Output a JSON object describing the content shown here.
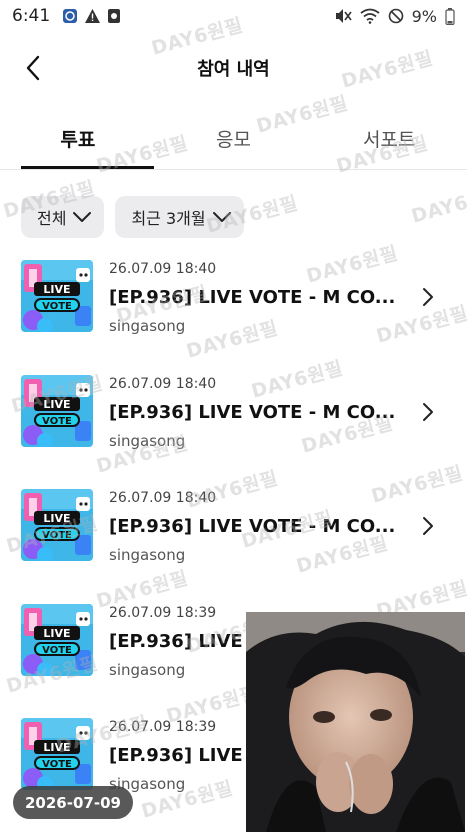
{
  "status_bar": {
    "time": "6:41",
    "battery": "9%"
  },
  "header": {
    "title": "참여 내역"
  },
  "tabs": [
    {
      "label": "투표",
      "active": true
    },
    {
      "label": "응모",
      "active": false
    },
    {
      "label": "서포트",
      "active": false
    }
  ],
  "filters": {
    "type": "전체",
    "period": "최근 3개월"
  },
  "items": [
    {
      "date": "26.07.09 18:40",
      "title": "[EP.936] LIVE VOTE - M CO...",
      "subtitle": "singasong",
      "thumb_text_1": "LIVE",
      "thumb_text_2": "VOTE"
    },
    {
      "date": "26.07.09 18:40",
      "title": "[EP.936] LIVE VOTE - M CO...",
      "subtitle": "singasong",
      "thumb_text_1": "LIVE",
      "thumb_text_2": "VOTE"
    },
    {
      "date": "26.07.09 18:40",
      "title": "[EP.936] LIVE VOTE - M CO...",
      "subtitle": "singasong",
      "thumb_text_1": "LIVE",
      "thumb_text_2": "VOTE"
    },
    {
      "date": "26.07.09 18:39",
      "title": "[EP.936] LIVE",
      "subtitle": "singasong",
      "thumb_text_1": "LIVE",
      "thumb_text_2": "VOTE"
    },
    {
      "date": "26.07.09 18:39",
      "title": "[EP.936] LIVE",
      "subtitle": "singasong",
      "thumb_text_1": "LIVE",
      "thumb_text_2": "VOTE"
    }
  ],
  "watermark": "DAY6원필",
  "date_badge": "2026-07-09",
  "icons": {
    "back": "chevron-left-icon",
    "dropdown": "chevron-down-icon",
    "row_arrow": "chevron-right-icon"
  },
  "colors": {
    "chip_bg": "#ececef",
    "active_underline": "#111111"
  }
}
